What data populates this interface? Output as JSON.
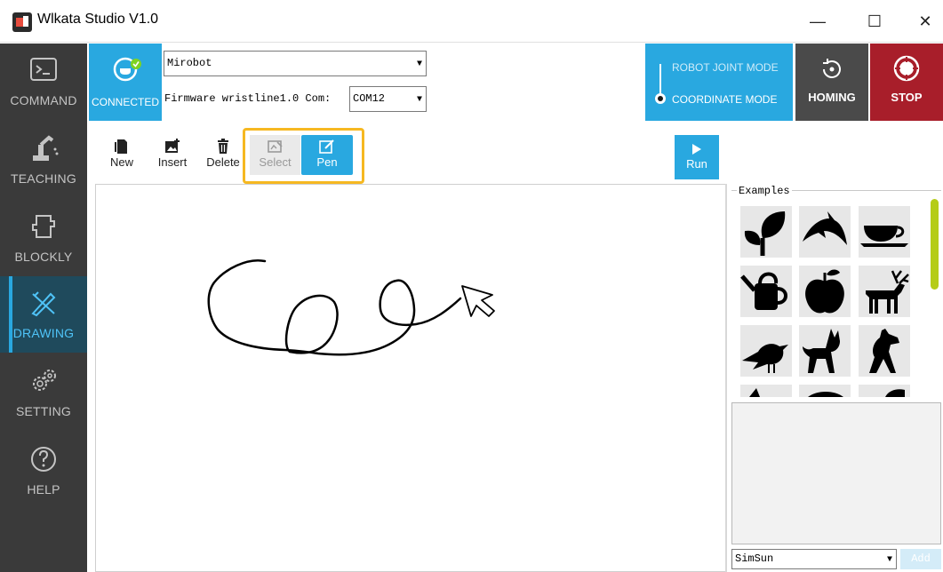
{
  "window": {
    "title": "Wlkata Studio V1.0",
    "minimize": "—",
    "maximize": "☐",
    "close": "✕"
  },
  "sidebar": {
    "items": [
      {
        "label": "COMMAND",
        "icon": "terminal-icon"
      },
      {
        "label": "TEACHING",
        "icon": "robot-arm-icon"
      },
      {
        "label": "BLOCKLY",
        "icon": "puzzle-icon"
      },
      {
        "label": "DRAWING",
        "icon": "drawing-pen-icon",
        "active": true
      },
      {
        "label": "SETTING",
        "icon": "gears-icon"
      },
      {
        "label": "HELP",
        "icon": "help-icon"
      }
    ]
  },
  "connection": {
    "status_label": "CONNECTED",
    "device_value": "Mirobot",
    "firmware_text": "Firmware wristline1.0 Com:",
    "com_value": "COM12"
  },
  "mode": {
    "joint_label": "ROBOT JOINT MODE",
    "coordinate_label": "COORDINATE MODE",
    "selected": "COORDINATE MODE"
  },
  "actions": {
    "homing_label": "HOMING",
    "stop_label": "STOP",
    "run_label": "Run"
  },
  "toolbar": {
    "new_label": "New",
    "insert_label": "Insert",
    "delete_label": "Delete",
    "select_label": "Select",
    "pen_label": "Pen",
    "active_tool": "Pen"
  },
  "examples": {
    "legend": "Examples",
    "items": [
      "leaf",
      "dolphin",
      "teacup",
      "watering-can",
      "apple",
      "deer",
      "bird",
      "cat",
      "dog"
    ]
  },
  "font": {
    "value": "SimSun",
    "add_label": "Add"
  },
  "colors": {
    "accent": "#29a8e0",
    "sidebar_bg": "#3a3a3a",
    "stop": "#a81e2a",
    "homing": "#4a4a4a",
    "highlight": "#f6b821",
    "scrollbar": "#b5cc18"
  }
}
